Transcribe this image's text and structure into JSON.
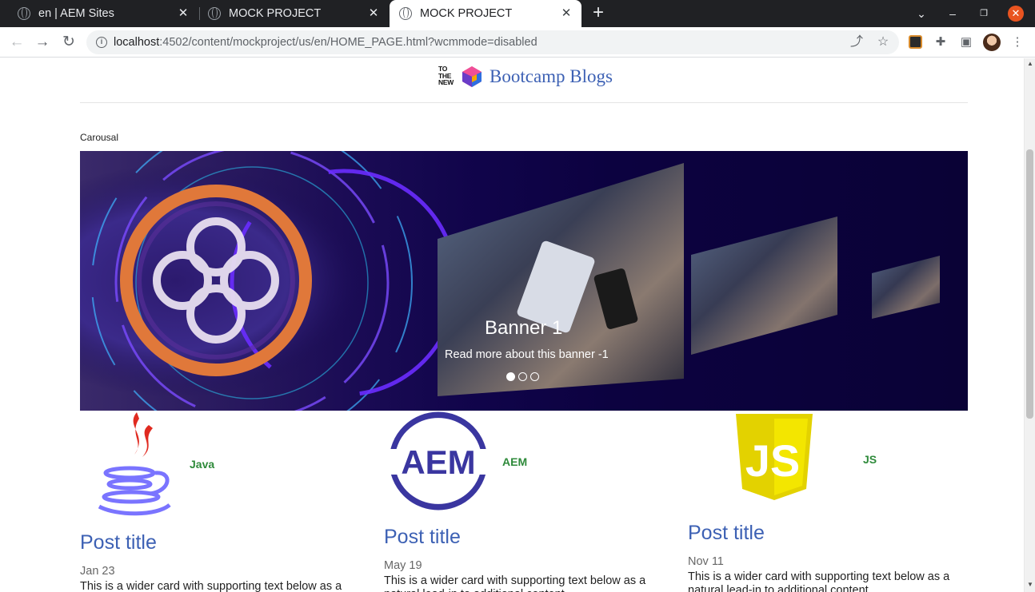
{
  "browser": {
    "tabs": [
      {
        "title": "en | AEM Sites",
        "active": false
      },
      {
        "title": "MOCK PROJECT",
        "active": false
      },
      {
        "title": "MOCK PROJECT",
        "active": true
      }
    ],
    "url_host": "localhost",
    "url_path": ":4502/content/mockproject/us/en/HOME_PAGE.html?wcmmode=disabled",
    "icons": [
      "back-icon",
      "forward-icon",
      "reload-icon",
      "info-icon",
      "share-icon",
      "bookmark-star-icon",
      "extensions-icon",
      "side-panel-icon",
      "menu-icon"
    ]
  },
  "header": {
    "logo_text": "TO THE NEW",
    "site_title": "Bootcamp Blogs"
  },
  "carousel": {
    "section_label": "Carousal",
    "banner_title": "Banner 1",
    "banner_text": "Read more about this banner -1",
    "slide_count": 3,
    "active_index": 0
  },
  "cards": [
    {
      "tag": "Java",
      "logo": "java-logo-icon",
      "title": "Post title",
      "date": "Jan 23",
      "text": "This is a wider card with supporting text below as a natural lead-in to additional content."
    },
    {
      "tag": "AEM",
      "logo": "aem-logo-icon",
      "title": "Post title",
      "date": "May 19",
      "text": "This is a wider card with supporting text below as a natural lead-in to additional content."
    },
    {
      "tag": "JS",
      "logo": "js-logo-icon",
      "title": "Post title",
      "date": "Nov 11",
      "text": "This is a wider card with supporting text below as a natural lead-in to additional content."
    }
  ],
  "colors": {
    "link_blue": "#3d61b4",
    "tag_green": "#2e8a3a",
    "carousel_bg": "#0c0240"
  }
}
